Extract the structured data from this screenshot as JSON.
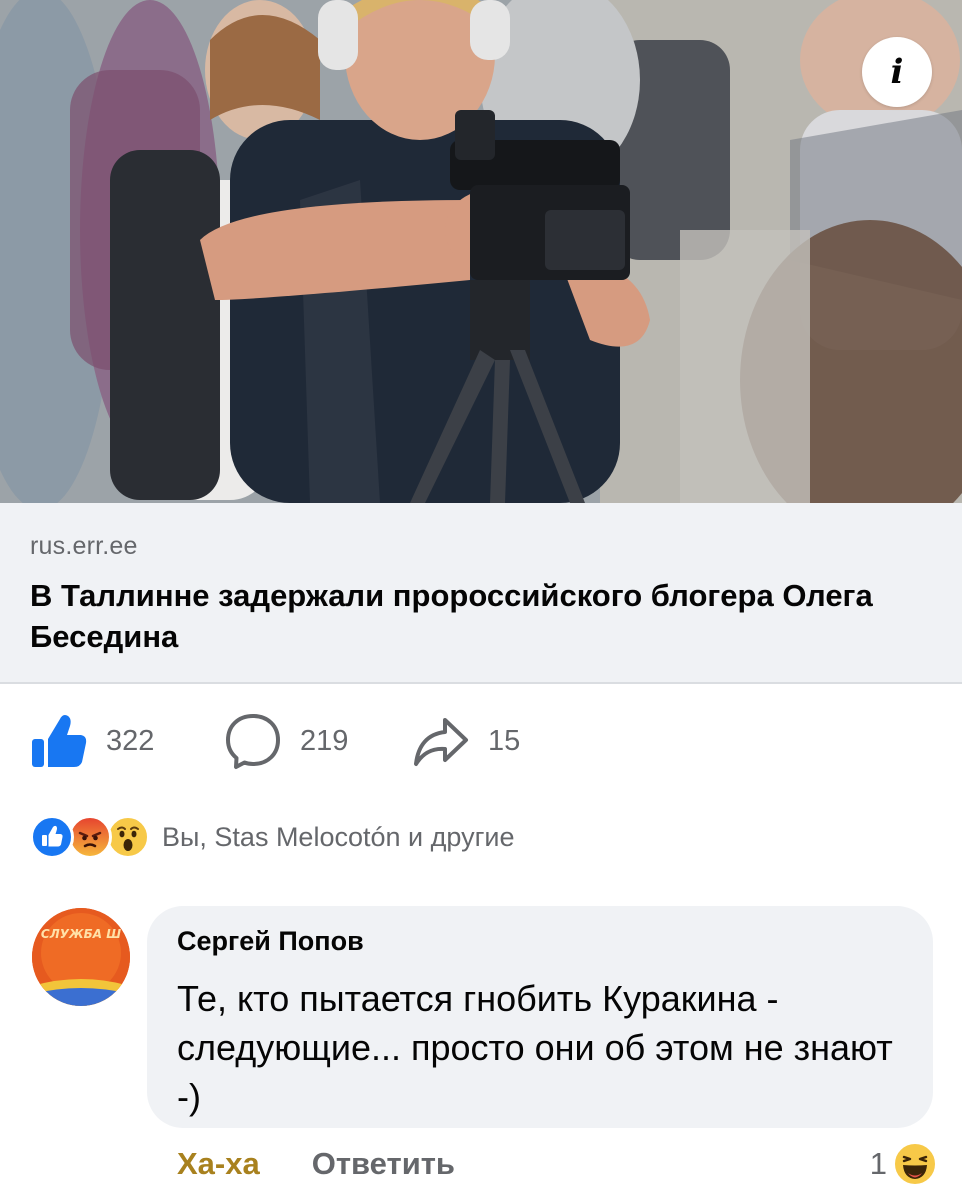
{
  "link_preview": {
    "domain": "rus.err.ee",
    "title": "В Таллинне задержали пророссийского блогера Олега Беседина",
    "info_button": "i"
  },
  "actions": {
    "likes": "322",
    "comments": "219",
    "shares": "15"
  },
  "reactions": {
    "summary": "Вы, Stas Melocotón и другие",
    "icons": [
      "like-reaction-icon",
      "angry-reaction-icon",
      "wow-reaction-icon"
    ]
  },
  "comment": {
    "author": "Сергей Попов",
    "text": "Те, кто пытается гнобить Куракина - следующие... просто они об этом не знают -)",
    "react_label": "Ха-ха",
    "reply_label": "Ответить",
    "reaction_count": "1",
    "avatar_text": "СЛУЖБА Ш"
  },
  "colors": {
    "facebook_blue": "#1877f2",
    "secondary_text": "#65676b",
    "haha_gold": "#a8811e",
    "bubble_bg": "#f0f2f5"
  }
}
